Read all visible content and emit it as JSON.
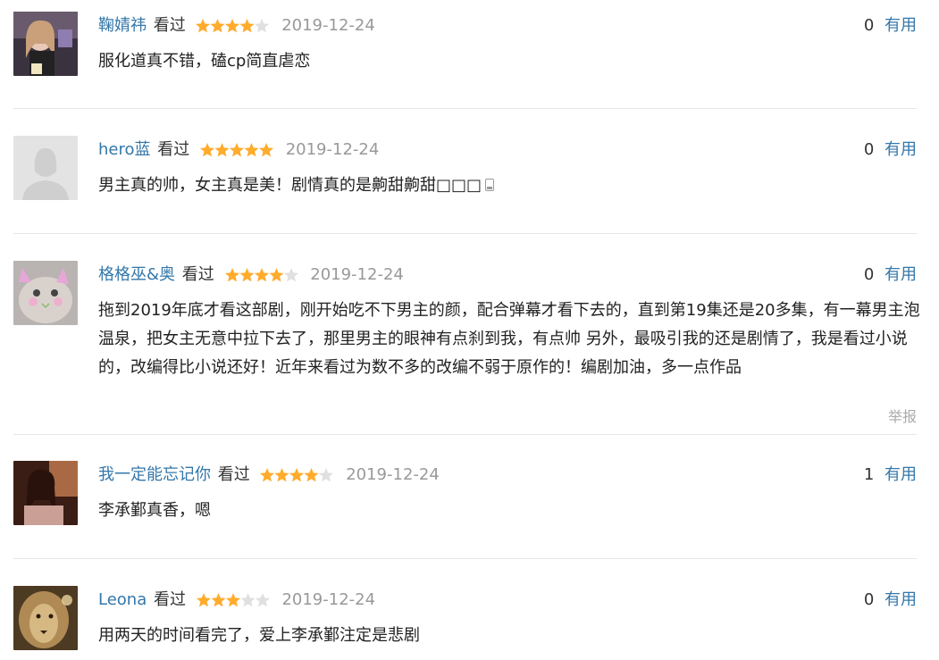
{
  "colors": {
    "link": "#3377aa",
    "star": "#ffac2d",
    "star_empty": "#e0e0e0",
    "date": "#999999"
  },
  "reviews": [
    {
      "user": "鞠婧祎",
      "status": "看过",
      "rating": 4,
      "date": "2019-12-24",
      "useful_count": "0",
      "useful_label": "有用",
      "text": "服化道真不错，磕cp简直虐恋",
      "avatar": "photo-avatar-girl"
    },
    {
      "user": "hero蓝",
      "status": "看过",
      "rating": 5,
      "date": "2019-12-24",
      "useful_count": "0",
      "useful_label": "有用",
      "text": "男主真的帅，女主真是美！剧情真的是齁甜齁甜□□□",
      "avatar": "default-avatar-icon"
    },
    {
      "user": "格格巫&奥",
      "status": "看过",
      "rating": 4,
      "date": "2019-12-24",
      "useful_count": "0",
      "useful_label": "有用",
      "text": "拖到2019年底才看这部剧，刚开始吃不下男主的颜，配合弹幕才看下去的，直到第19集还是20多集，有一幕男主泡温泉，把女主无意中拉下去了，那里男主的眼神有点刹到我，有点帅 另外，最吸引我的还是剧情了，我是看过小说的，改编得比小说还好！近年来看过为数不多的改编不弱于原作的！编剧加油，多一点作品",
      "report": "举报",
      "avatar": "photo-avatar-cat"
    },
    {
      "user": "我一定能忘记你",
      "status": "看过",
      "rating": 4,
      "date": "2019-12-24",
      "useful_count": "1",
      "useful_label": "有用",
      "text": "李承鄞真香，嗯",
      "avatar": "photo-avatar-woman"
    },
    {
      "user": "Leona",
      "status": "看过",
      "rating": 3,
      "date": "2019-12-24",
      "useful_count": "0",
      "useful_label": "有用",
      "text": "用两天的时间看完了，爱上李承鄞注定是悲剧",
      "avatar": "photo-avatar-lion"
    }
  ]
}
